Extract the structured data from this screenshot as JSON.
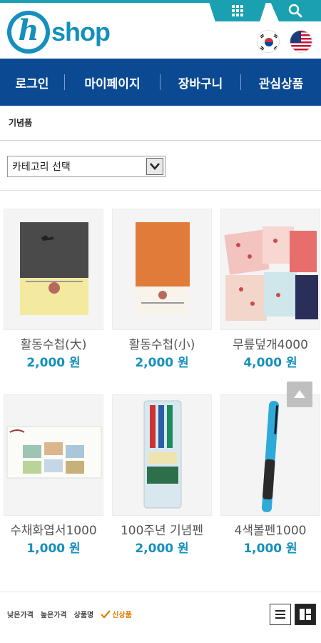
{
  "header": {
    "logo_letter": "h",
    "logo_text": "shop"
  },
  "nav": {
    "items": [
      {
        "label": "로그인"
      },
      {
        "label": "마이페이지"
      },
      {
        "label": "장바구니"
      },
      {
        "label": "관심상품"
      }
    ]
  },
  "breadcrumb": {
    "label": "기념품"
  },
  "category_select": {
    "selected": "카테고리 선택"
  },
  "products": [
    {
      "name": "활동수첩(大)",
      "price": "2,000 원"
    },
    {
      "name": "활동수첩(小)",
      "price": "2,000 원"
    },
    {
      "name": "무릎덮개4000",
      "price": "4,000 원"
    },
    {
      "name": "수채화엽서1000",
      "price": "1,000 원"
    },
    {
      "name": "100주년 기념펜",
      "price": "2,000 원"
    },
    {
      "name": "4색볼펜1000",
      "price": "1,000 원"
    }
  ],
  "sort": {
    "low_price": "낮은가격",
    "high_price": "높은가격",
    "name": "상품명",
    "new": "신상품"
  },
  "colors": {
    "brand_blue": "#1590bd",
    "nav_blue": "#0b4a93",
    "teal": "#1aa0b0",
    "active_sort": "#e07b00"
  }
}
